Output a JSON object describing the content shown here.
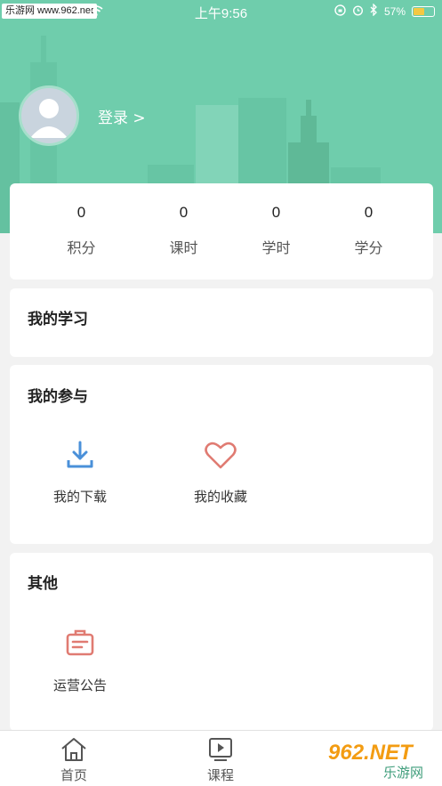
{
  "status_bar": {
    "watermark": "乐游网 www.962.net",
    "time": "上午9:56",
    "battery": "57%",
    "battery_level": 0.57,
    "icons": [
      "wifi-icon",
      "orientation-lock-icon",
      "alarm-icon",
      "bluetooth-icon",
      "battery-icon"
    ]
  },
  "profile": {
    "login_label": "登录 >"
  },
  "stats": [
    {
      "value": "0",
      "label": "积分"
    },
    {
      "value": "0",
      "label": "课时"
    },
    {
      "value": "0",
      "label": "学时"
    },
    {
      "value": "0",
      "label": "学分"
    }
  ],
  "sections": {
    "study": {
      "title": "我的学习"
    },
    "participation": {
      "title": "我的参与",
      "items": [
        {
          "label": "我的下载",
          "icon": "download-icon"
        },
        {
          "label": "我的收藏",
          "icon": "heart-icon"
        }
      ]
    },
    "other": {
      "title": "其他",
      "items": [
        {
          "label": "运营公告",
          "icon": "announcement-icon"
        }
      ]
    }
  },
  "bottom_nav": {
    "items": [
      {
        "label": "首页",
        "icon": "home-icon"
      },
      {
        "label": "课程",
        "icon": "play-icon"
      }
    ]
  },
  "brand_watermark": {
    "line1": "962.NET",
    "line2": "乐游网"
  },
  "colors": {
    "header": "#6fcdac",
    "download_icon": "#4a90d9",
    "heart_icon": "#e07b72",
    "announcement_icon": "#e07b72",
    "watermark_orange": "#f39c12"
  }
}
